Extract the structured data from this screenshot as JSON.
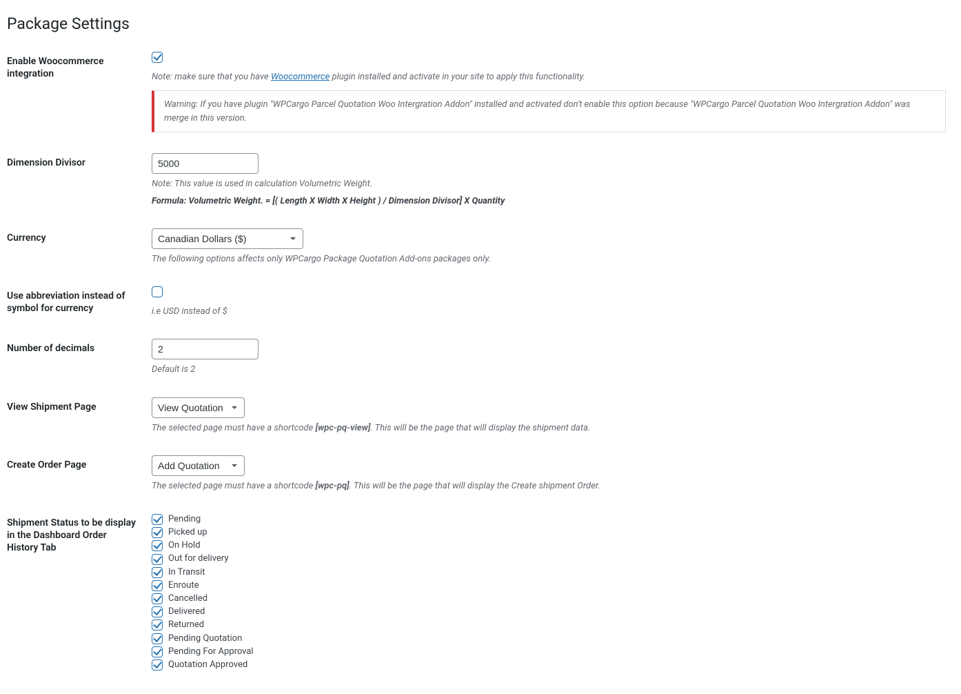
{
  "page_title": "Package Settings",
  "fields": {
    "woocommerce": {
      "label": "Enable Woocommerce integration",
      "checked": true,
      "note_prefix": "Note: make sure that you have ",
      "note_link_text": "Woocommerce",
      "note_suffix": " plugin installed and activate in your site to apply this functionality.",
      "warning": "Warning: If you have plugin \"WPCargo Parcel Quotation Woo Intergration Addon\" installed and activated don't enable this option because \"WPCargo Parcel Quotation Woo Intergration Addon\" was merge in this version."
    },
    "dimension_divisor": {
      "label": "Dimension Divisor",
      "value": "5000",
      "note": "Note: This value is used in calculation Volumetric Weight.",
      "formula": "Formula: Volumetric Weight. = [( Length X Width X Height ) / Dimension Divisor] X Quantity"
    },
    "currency": {
      "label": "Currency",
      "value": "Canadian Dollars ($)",
      "note": "The following options affects only WPCargo Package Quotation Add-ons packages only."
    },
    "abbreviation": {
      "label": "Use abbreviation instead of symbol for currency",
      "checked": false,
      "note": "i.e USD instead of $"
    },
    "decimals": {
      "label": "Number of decimals",
      "value": "2",
      "note": "Default is 2"
    },
    "view_shipment": {
      "label": "View Shipment Page",
      "value": "View Quotation",
      "note_pre": "The selected page must have a shortcode ",
      "shortcode": "[wpc-pq-view]",
      "note_post": ". This will be the page that will display the shipment data."
    },
    "create_order": {
      "label": "Create Order Page",
      "value": "Add Quotation",
      "note_pre": "The selected page must have a shortcode ",
      "shortcode": "[wpc-pq]",
      "note_post": ". This will be the page that will display the Create shipment Order."
    },
    "shipment_status": {
      "label": "Shipment Status to be display in the Dashboard Order History Tab",
      "options": [
        {
          "label": "Pending",
          "checked": true
        },
        {
          "label": "Picked up",
          "checked": true
        },
        {
          "label": "On Hold",
          "checked": true
        },
        {
          "label": "Out for delivery",
          "checked": true
        },
        {
          "label": "In Transit",
          "checked": true
        },
        {
          "label": "Enroute",
          "checked": true
        },
        {
          "label": "Cancelled",
          "checked": true
        },
        {
          "label": "Delivered",
          "checked": true
        },
        {
          "label": "Returned",
          "checked": true
        },
        {
          "label": "Pending Quotation",
          "checked": true
        },
        {
          "label": "Pending For Approval",
          "checked": true
        },
        {
          "label": "Quotation Approved",
          "checked": true
        }
      ]
    }
  }
}
